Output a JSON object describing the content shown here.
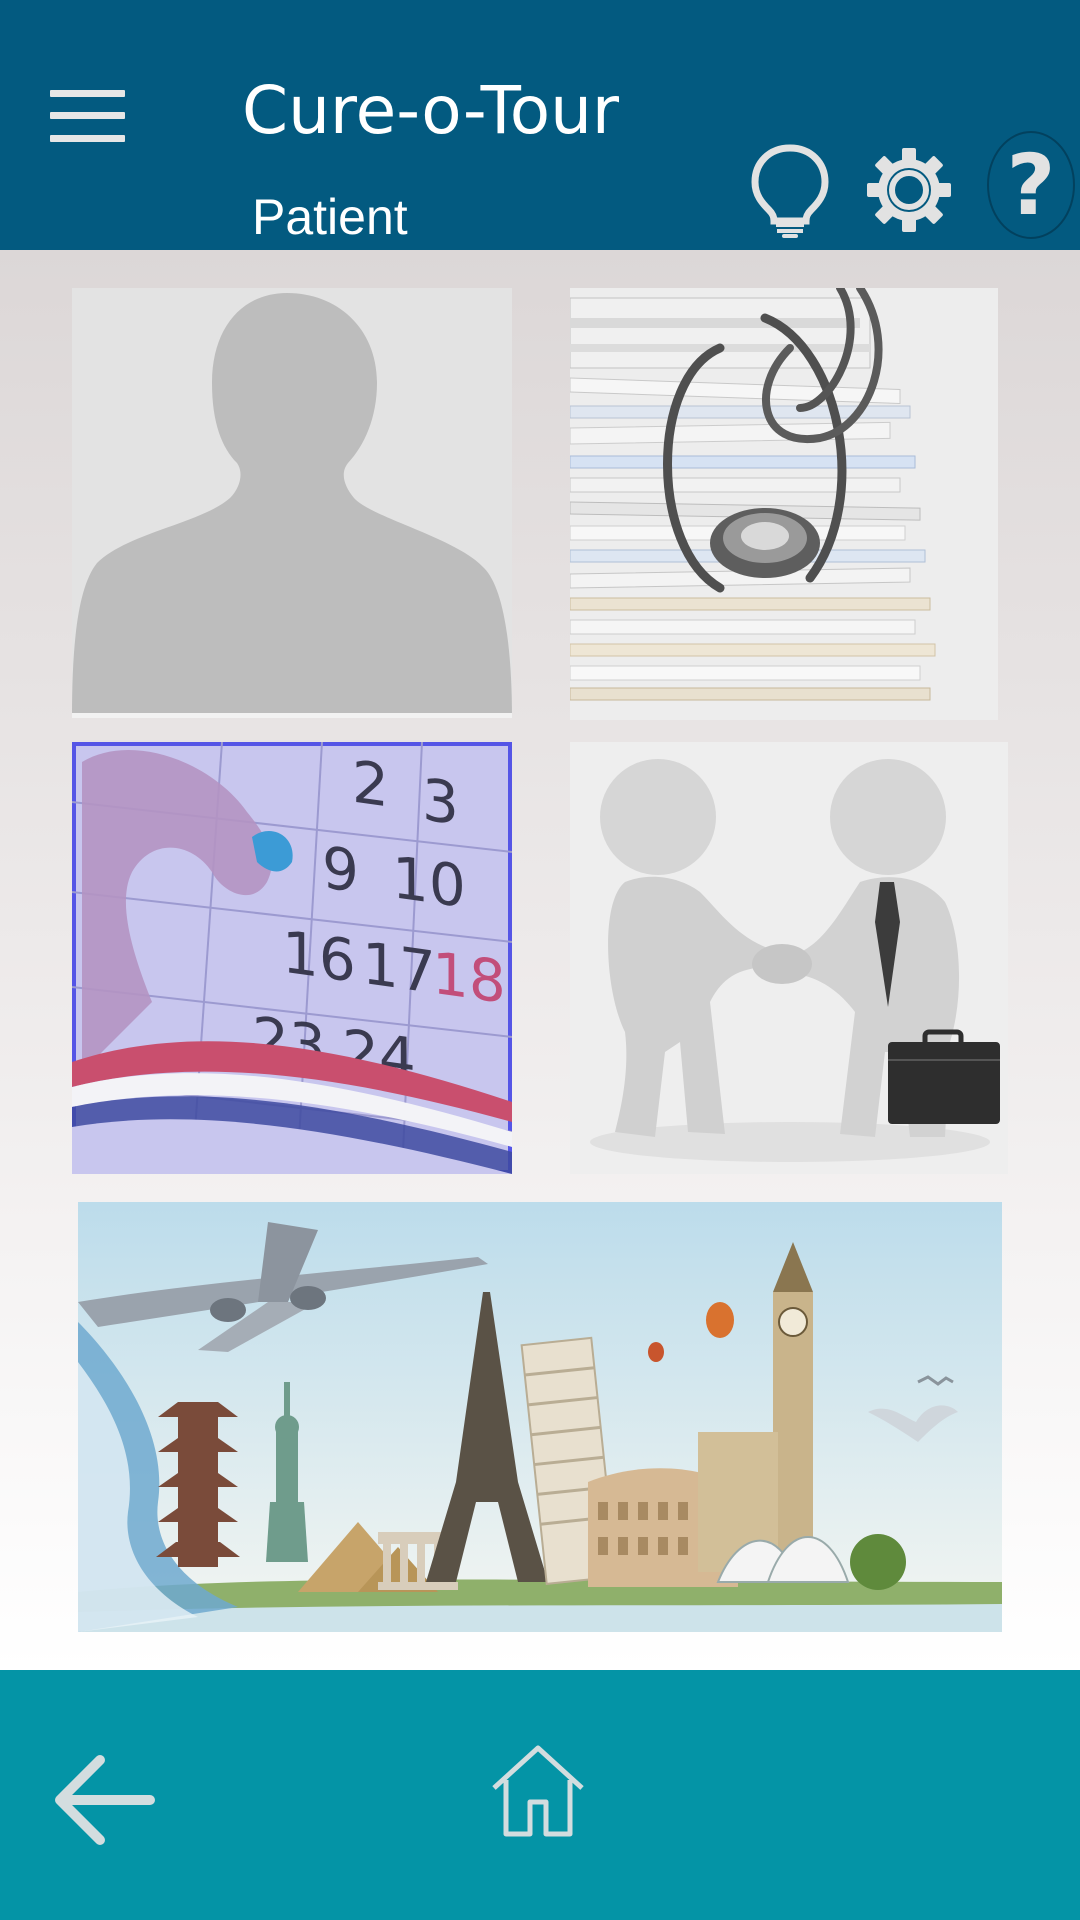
{
  "header": {
    "title": "Cure-o-Tour",
    "role": "Patient",
    "background_color": "#035a80",
    "icons": {
      "menu": "hamburger-menu-icon",
      "tips": "lightbulb-icon",
      "settings": "gear-icon",
      "help": "question-mark-icon"
    }
  },
  "tiles": [
    {
      "name": "profile",
      "image": "person-silhouette"
    },
    {
      "name": "medical-records",
      "image": "stethoscope-on-document-stack"
    },
    {
      "name": "appointments",
      "image": "calendar-with-finger"
    },
    {
      "name": "doctor-connect",
      "image": "handshake-figures"
    },
    {
      "name": "travel",
      "image": "world-landmarks-and-airplane"
    }
  ],
  "bottom_bar": {
    "background_color": "#0494a6",
    "icons": {
      "back": "back-arrow-icon",
      "home": "home-icon"
    }
  }
}
